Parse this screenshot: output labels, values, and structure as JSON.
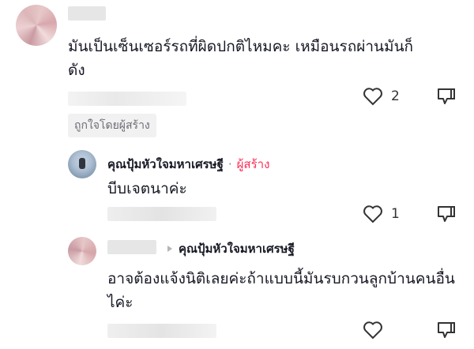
{
  "comments": [
    {
      "text": "มันเป็นเซ็นเซอร์รถที่ผิดปกติไหมคะ เหมือนรถผ่านมันก็ดัง",
      "like_count": "2",
      "liked_by_creator_label": "ถูกใจโดยผู้สร้าง"
    }
  ],
  "replies": [
    {
      "author": "คุณปุ้มหัวใจมหาเศรษฐี",
      "separator": "·",
      "creator_label": "ผู้สร้าง",
      "text": "บีบเจตนาค่ะ",
      "like_count": "1"
    },
    {
      "reply_to": "คุณปุ้มหัวใจมหาเศรษฐี",
      "text": "อาจต้องแจ้งนิติเลยค่ะถ้าแบบนี้มันรบกวนลูกบ้านคนอื่นไค่ะ",
      "like_count": ""
    }
  ],
  "icons": [
    "heart-icon",
    "dislike-icon",
    "reply-arrow-icon"
  ],
  "colors": {
    "creator": "#fe2c55",
    "text": "#161823"
  }
}
